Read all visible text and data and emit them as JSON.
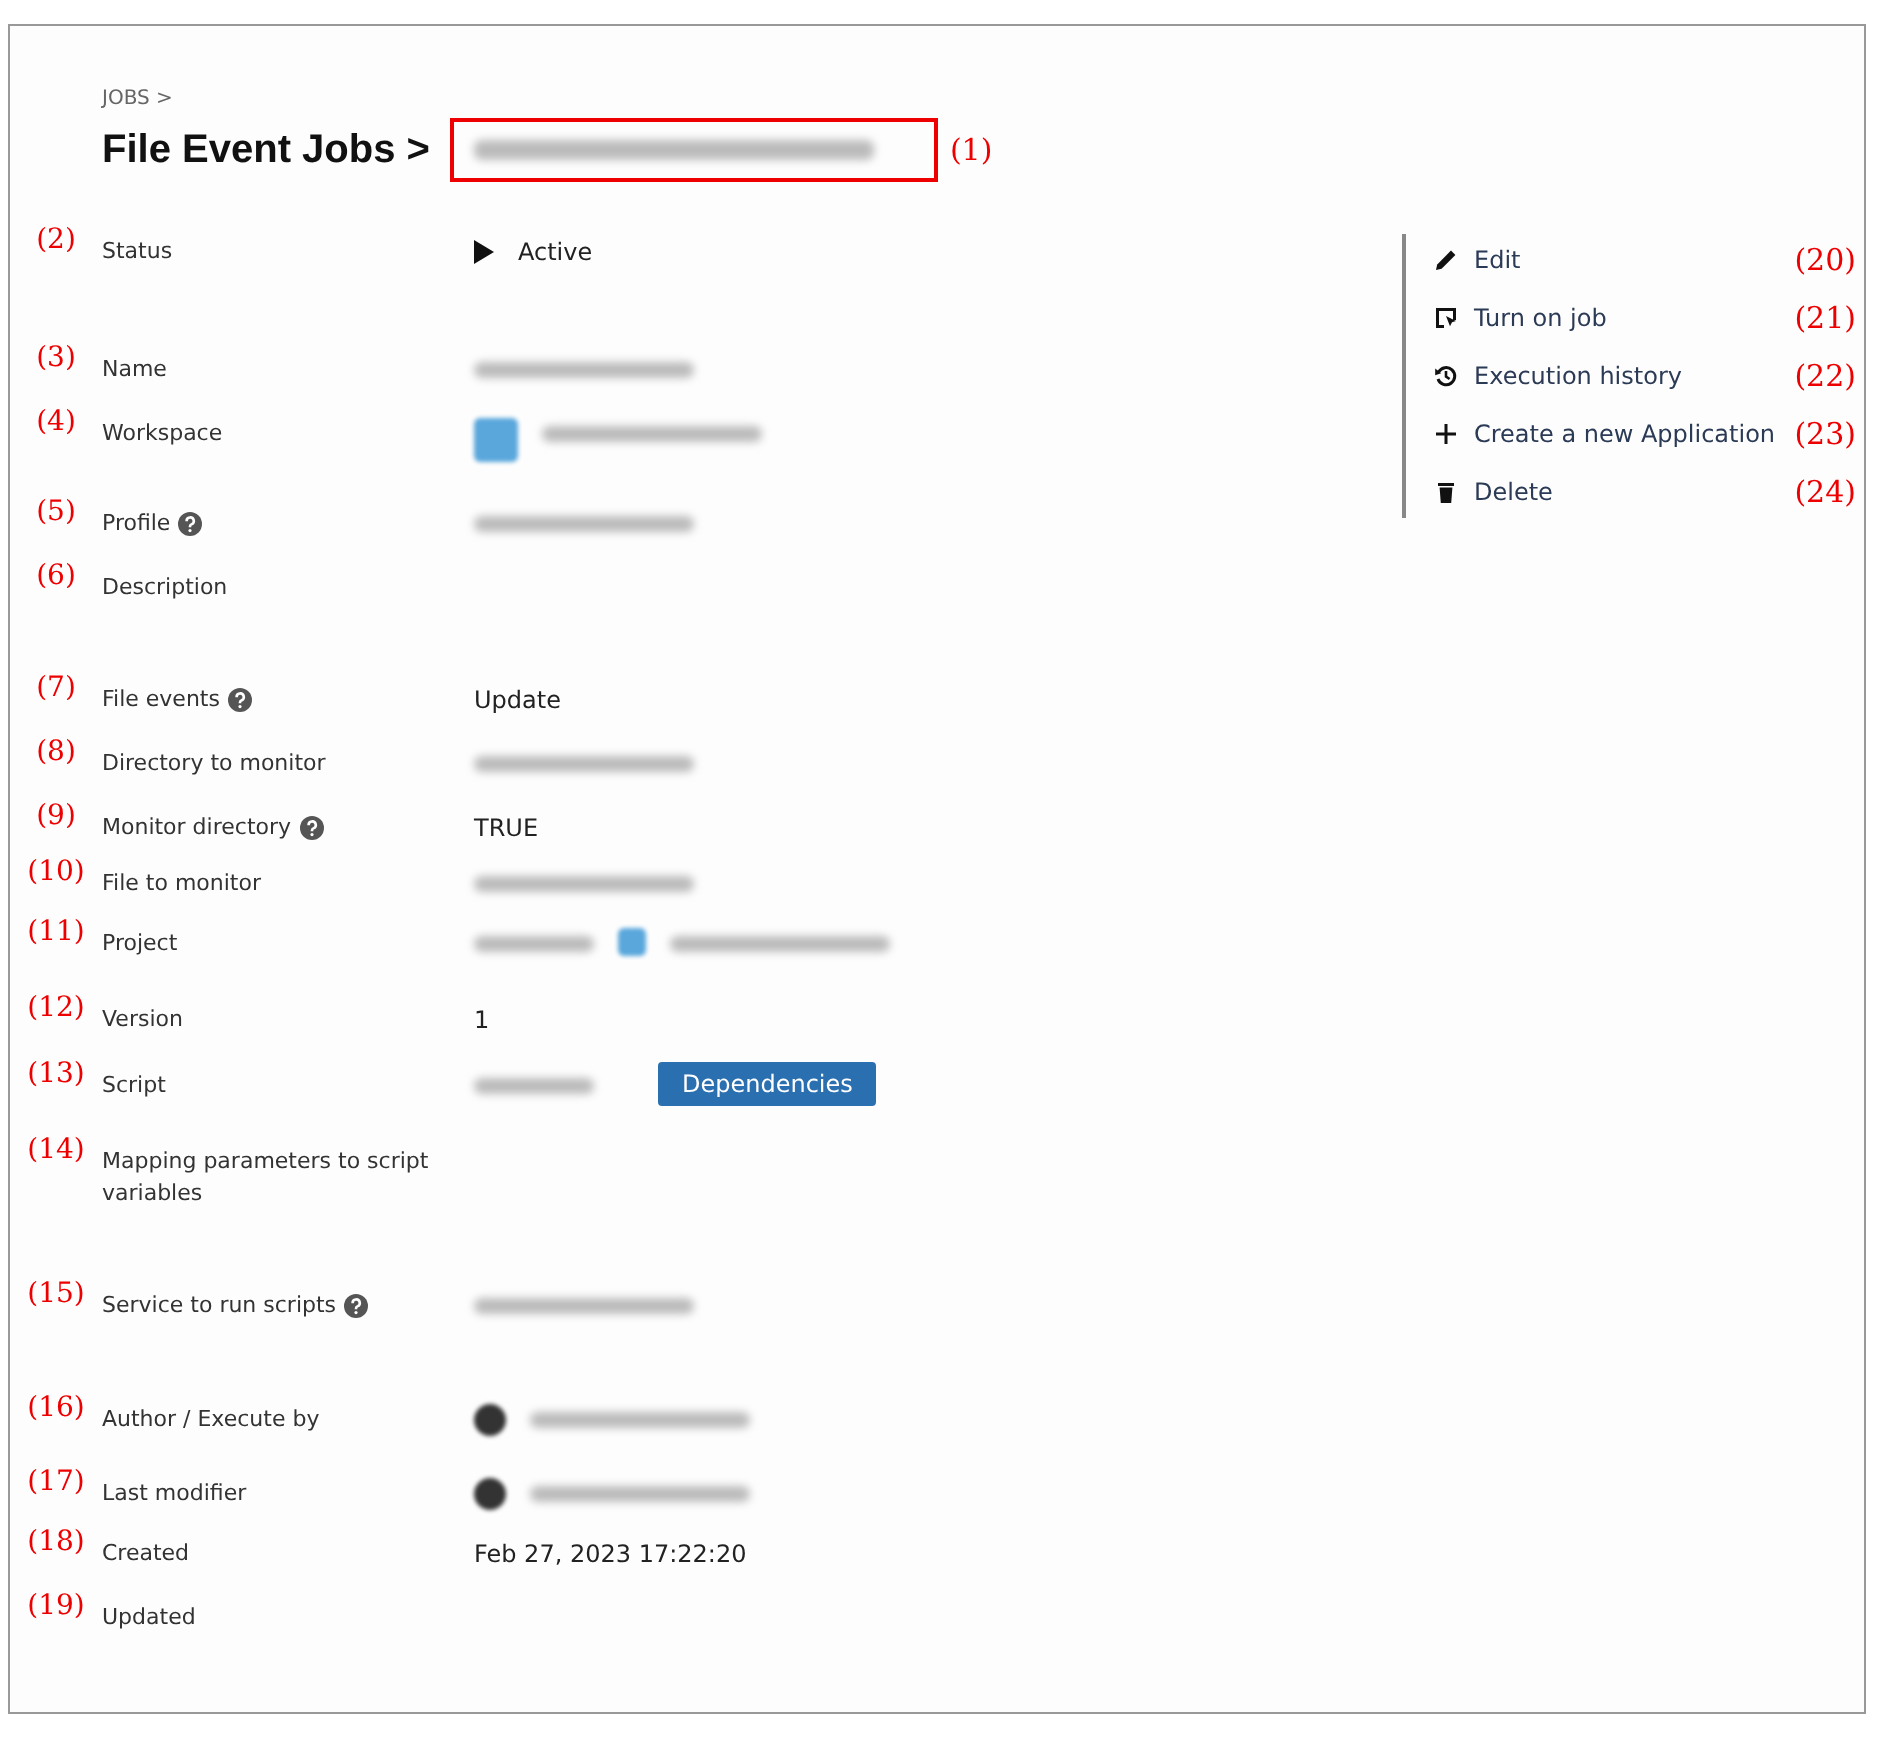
{
  "breadcrumb": "JOBS >",
  "title": {
    "text": "File Event Jobs >",
    "marker": "(1)"
  },
  "fields": [
    {
      "marker": "(2)",
      "label": "Status",
      "help": false,
      "kind": "status",
      "value": "Active"
    },
    {
      "marker": "(3)",
      "label": "Name",
      "help": false,
      "kind": "blurred"
    },
    {
      "marker": "(4)",
      "label": "Workspace",
      "help": false,
      "kind": "workspace"
    },
    {
      "marker": "(5)",
      "label": "Profile",
      "help": true,
      "kind": "blurred"
    },
    {
      "marker": "(6)",
      "label": "Description",
      "help": false,
      "kind": "empty"
    },
    {
      "marker": "(7)",
      "label": "File events",
      "help": true,
      "kind": "text",
      "value": "Update"
    },
    {
      "marker": "(8)",
      "label": "Directory to monitor",
      "help": false,
      "kind": "blurred"
    },
    {
      "marker": "(9)",
      "label": "Monitor directory",
      "help": true,
      "kind": "text",
      "value": "TRUE"
    },
    {
      "marker": "(10)",
      "label": "File to monitor",
      "help": false,
      "kind": "blurred"
    },
    {
      "marker": "(11)",
      "label": "Project",
      "help": false,
      "kind": "project"
    },
    {
      "marker": "(12)",
      "label": "Version",
      "help": false,
      "kind": "text",
      "value": "1"
    },
    {
      "marker": "(13)",
      "label": "Script",
      "help": false,
      "kind": "script",
      "button": "Dependencies"
    },
    {
      "marker": "(14)",
      "label": "Mapping parameters to script variables",
      "help": false,
      "kind": "empty"
    },
    {
      "marker": "(15)",
      "label": "Service to run scripts",
      "help": true,
      "kind": "blurred"
    },
    {
      "marker": "(16)",
      "label": "Author / Execute by",
      "help": false,
      "kind": "user"
    },
    {
      "marker": "(17)",
      "label": "Last modifier",
      "help": false,
      "kind": "user"
    },
    {
      "marker": "(18)",
      "label": "Created",
      "help": false,
      "kind": "text",
      "value": "Feb 27, 2023 17:22:20"
    },
    {
      "marker": "(19)",
      "label": "Updated",
      "help": false,
      "kind": "empty"
    }
  ],
  "actions": [
    {
      "kind": "edit",
      "label": "Edit",
      "marker": "(20)"
    },
    {
      "kind": "turn-on",
      "label": "Turn on job",
      "marker": "(21)"
    },
    {
      "kind": "history",
      "label": "Execution history",
      "marker": "(22)"
    },
    {
      "kind": "create",
      "label": "Create a new Application",
      "marker": "(23)"
    },
    {
      "kind": "delete",
      "label": "Delete",
      "marker": "(24)"
    }
  ]
}
